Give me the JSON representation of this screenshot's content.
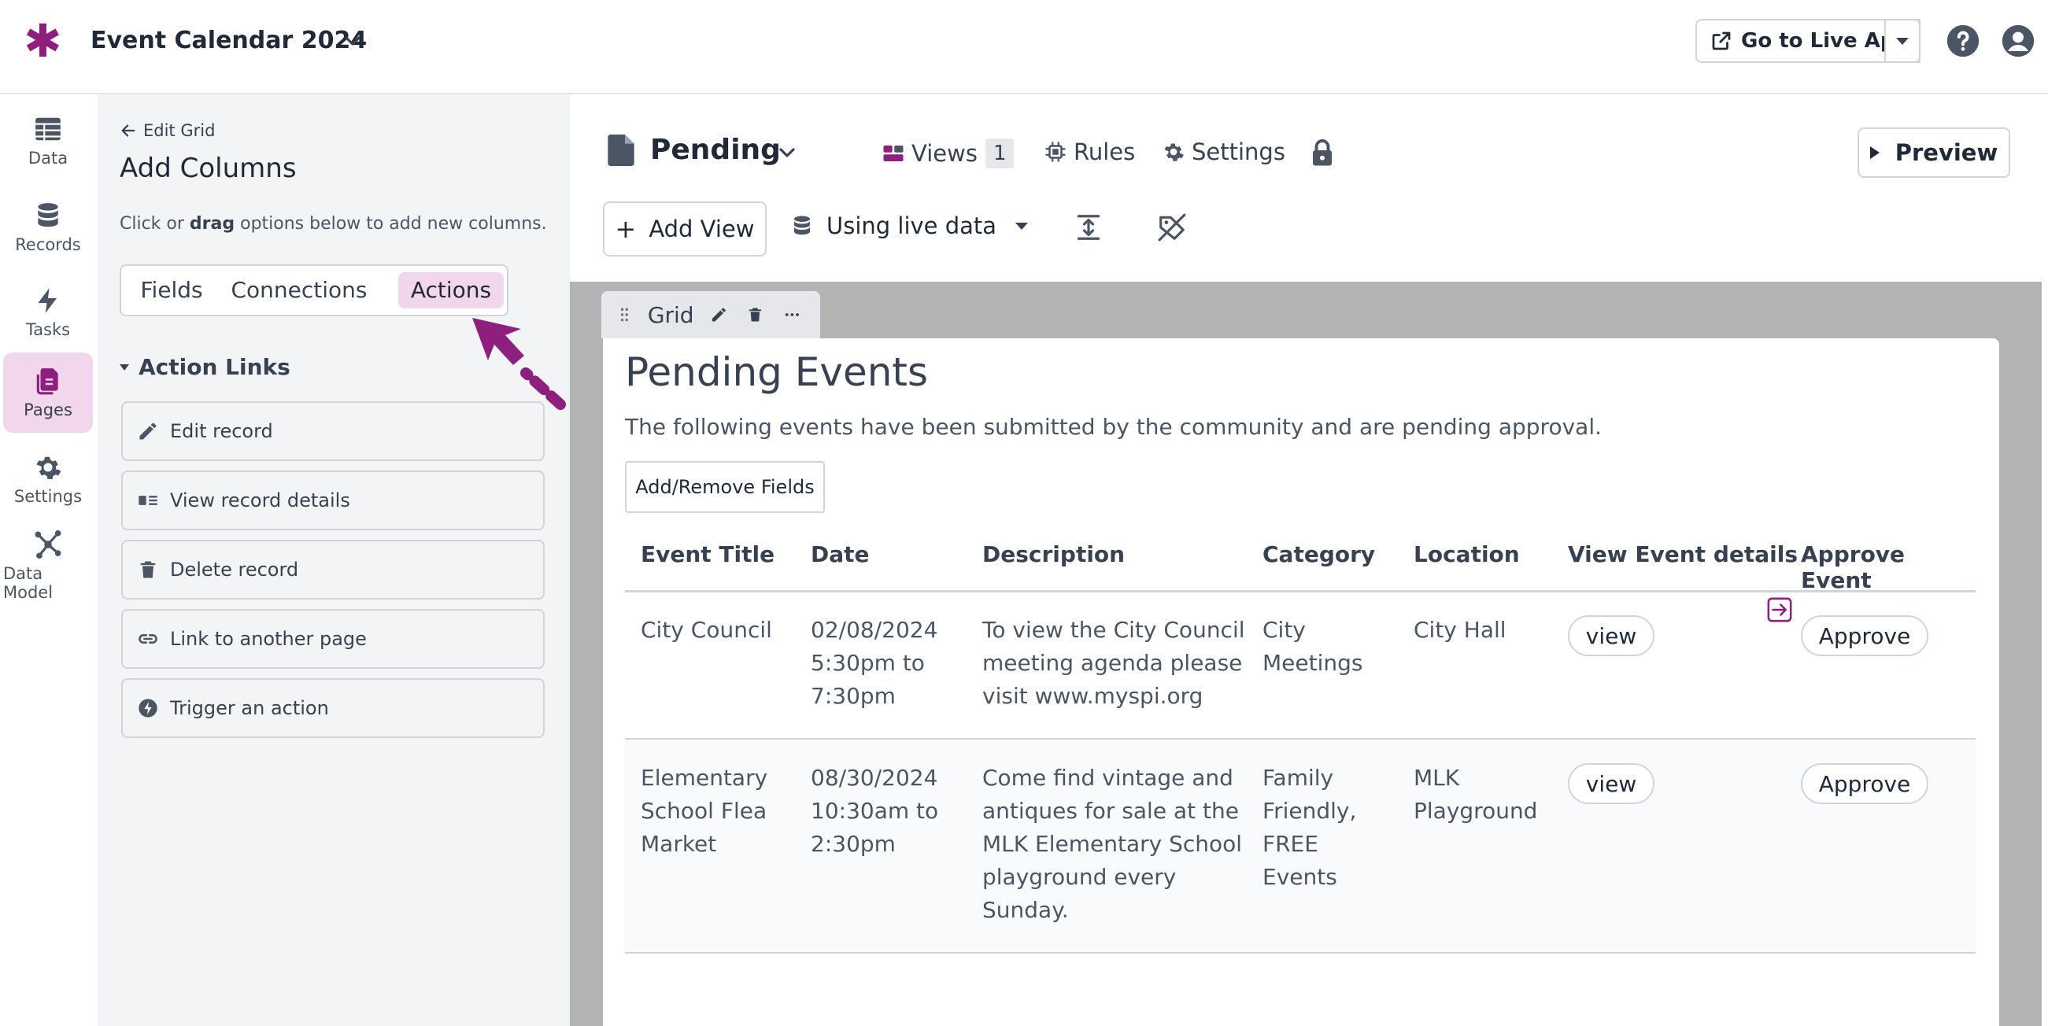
{
  "header": {
    "app_title": "Event Calendar 2024",
    "live_app_label": "Go to Live App"
  },
  "leftnav": {
    "items": [
      {
        "label": "Data",
        "icon": "table-icon"
      },
      {
        "label": "Records",
        "icon": "database-icon"
      },
      {
        "label": "Tasks",
        "icon": "lightning-icon"
      },
      {
        "label": "Pages",
        "icon": "pages-icon",
        "active": true
      },
      {
        "label": "Settings",
        "icon": "gear-icon"
      },
      {
        "label": "Data Model",
        "icon": "network-icon"
      }
    ]
  },
  "panel": {
    "back_label": "Edit Grid",
    "title": "Add Columns",
    "help_pre": "Click or ",
    "help_bold": "drag",
    "help_post": " options below to add new columns.",
    "tabs": [
      "Fields",
      "Connections",
      "Actions"
    ],
    "active_tab": "Actions",
    "section_title": "Action Links",
    "actions": [
      {
        "label": "Edit record",
        "icon": "pencil-icon"
      },
      {
        "label": "View record details",
        "icon": "details-icon"
      },
      {
        "label": "Delete record",
        "icon": "trash-icon"
      },
      {
        "label": "Link to another page",
        "icon": "link-icon"
      },
      {
        "label": "Trigger an action",
        "icon": "bolt-circle-icon"
      }
    ]
  },
  "main": {
    "page_name": "Pending",
    "views_label": "Views",
    "views_count": "1",
    "rules_label": "Rules",
    "settings_label": "Settings",
    "preview_label": "Preview",
    "add_view_label": "Add View",
    "data_source_label": "Using live data"
  },
  "grid": {
    "tab_label": "Grid",
    "title": "Pending Events",
    "description": "The following events have been submitted by the community and are pending approval.",
    "fields_button": "Add/Remove Fields",
    "columns": [
      "Event Title",
      "Date",
      "Description",
      "Category",
      "Location",
      "View Event details",
      "Approve Event"
    ],
    "rows": [
      {
        "title": [
          "City Council"
        ],
        "date": [
          "02/08/2024",
          "5:30pm to",
          "7:30pm"
        ],
        "description": [
          "To view the City Council",
          "meeting agenda please",
          "visit www.myspi.org"
        ],
        "category": [
          "City",
          "Meetings"
        ],
        "location": [
          "City Hall"
        ],
        "view_label": "view",
        "approve_label": "Approve"
      },
      {
        "title": [
          "Elementary",
          "School Flea",
          "Market"
        ],
        "date": [
          "08/30/2024",
          "10:30am to",
          "2:30pm"
        ],
        "description": [
          "Come find vintage and",
          "antiques for sale at the",
          "MLK Elementary School",
          "playground every",
          "Sunday."
        ],
        "category": [
          "Family",
          "Friendly,",
          "FREE",
          "Events"
        ],
        "location": [
          "MLK",
          "Playground"
        ],
        "view_label": "view",
        "approve_label": "Approve"
      }
    ]
  },
  "colors": {
    "brand": "#8e1f7e",
    "active_bg": "#f2d6ec",
    "canvas_bg": "#b4b4b4"
  }
}
